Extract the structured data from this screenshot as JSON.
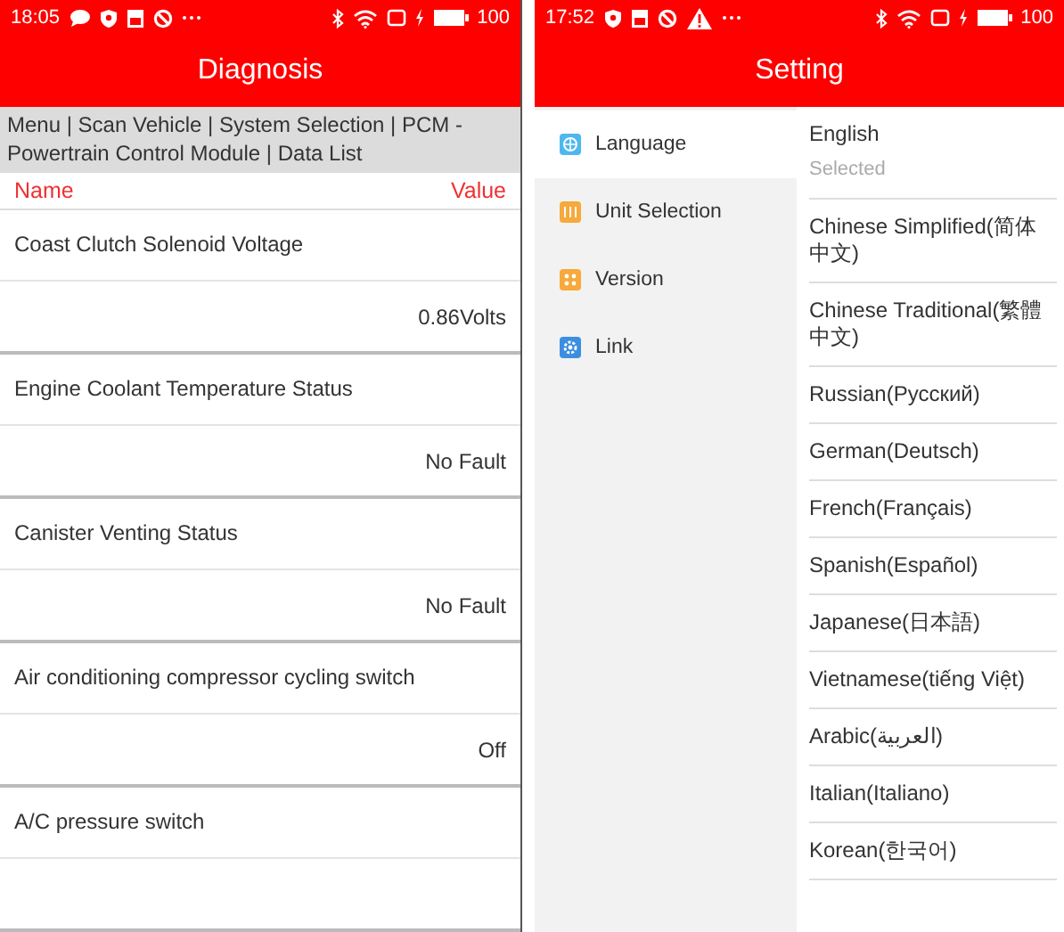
{
  "diagnosis_screen": {
    "status_bar": {
      "time": "18:05",
      "battery": "100"
    },
    "title": "Diagnosis",
    "breadcrumb": "Menu | Scan Vehicle | System Selection | PCM - Powertrain Control Module | Data List",
    "columns": [
      "Name",
      "Value"
    ],
    "rows": [
      {
        "name": "Coast Clutch Solenoid Voltage",
        "value": "0.86Volts"
      },
      {
        "name": "Engine Coolant Temperature Status",
        "value": "No Fault"
      },
      {
        "name": "Canister Venting Status",
        "value": "No Fault"
      },
      {
        "name": "Air conditioning compressor cycling switch",
        "value": "Off"
      },
      {
        "name": "A/C pressure switch"
      }
    ]
  },
  "setting_screen": {
    "status_bar": {
      "time": "17:52",
      "battery": "100"
    },
    "title": "Setting",
    "sidebar": {
      "items": [
        {
          "label": "Language",
          "selected": true
        },
        {
          "label": "Unit Selection",
          "selected": false
        },
        {
          "label": "Version",
          "selected": false
        },
        {
          "label": "Link",
          "selected": false
        }
      ]
    },
    "languages": [
      {
        "label": "English",
        "note": "Selected"
      },
      {
        "label": "Chinese Simplified(简体中文)"
      },
      {
        "label": "Chinese Traditional(繁體中文)"
      },
      {
        "label": "Russian(Русский)"
      },
      {
        "label": "German(Deutsch)"
      },
      {
        "label": "French(Français)"
      },
      {
        "label": "Spanish(Español)"
      },
      {
        "label": "Japanese(日本語)"
      },
      {
        "label": "Vietnamese(tiếng Việt)"
      },
      {
        "label": "Arabic(العربية)"
      },
      {
        "label": "Italian(Italiano)"
      },
      {
        "label": "Korean(한국어)"
      }
    ]
  }
}
